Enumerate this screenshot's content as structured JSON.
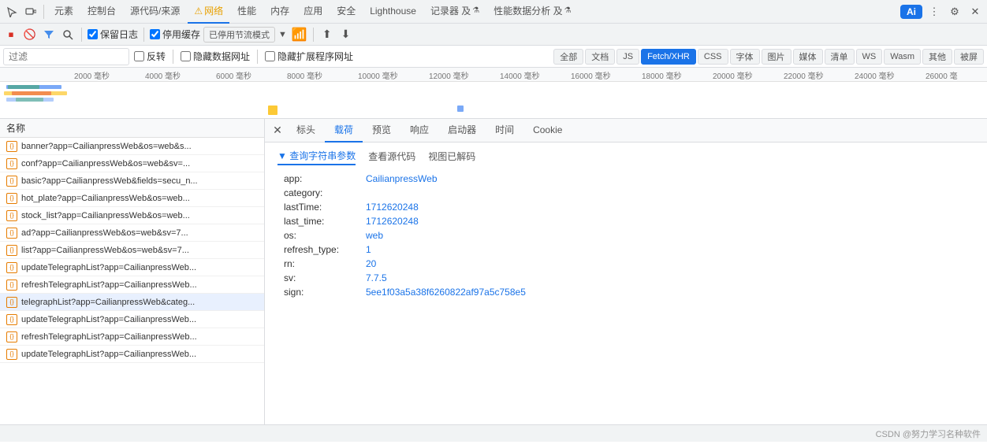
{
  "devtools": {
    "tabs": [
      {
        "label": "元素",
        "id": "elements",
        "active": false
      },
      {
        "label": "控制台",
        "id": "console",
        "active": false
      },
      {
        "label": "源代码/来源",
        "id": "sources",
        "active": false
      },
      {
        "label": "网络",
        "id": "network",
        "active": true,
        "warning": true
      },
      {
        "label": "性能",
        "id": "performance",
        "active": false
      },
      {
        "label": "内存",
        "id": "memory",
        "active": false
      },
      {
        "label": "应用",
        "id": "application",
        "active": false
      },
      {
        "label": "安全",
        "id": "security",
        "active": false
      },
      {
        "label": "Lighthouse",
        "id": "lighthouse",
        "active": false
      },
      {
        "label": "记录器 及",
        "id": "recorder",
        "active": false
      },
      {
        "label": "性能数据分析 及",
        "id": "perf-insights",
        "active": false
      }
    ],
    "toolbar_icons": [
      "cursor-icon",
      "box-icon"
    ]
  },
  "network": {
    "toolbar": {
      "record_title": "停止录制网络日志",
      "clear_title": "清除",
      "filter_title": "过滤",
      "search_title": "搜索",
      "preserve_log_label": "保留日志",
      "disable_cache_label": "停用缓存",
      "disabled_mode_label": "已停用节流模式",
      "upload_label": "导入",
      "download_label": "导出"
    },
    "filter": {
      "placeholder": "过滤",
      "invert_label": "反转",
      "hide_data_urls_label": "隐藏数据网址",
      "hide_extensions_label": "隐藏扩展程序网址"
    },
    "type_buttons": [
      {
        "label": "全部",
        "active": false
      },
      {
        "label": "文档",
        "active": false
      },
      {
        "label": "JS",
        "active": false
      },
      {
        "label": "Fetch/XHR",
        "active": true
      },
      {
        "label": "CSS",
        "active": false
      },
      {
        "label": "字体",
        "active": false
      },
      {
        "label": "图片",
        "active": false
      },
      {
        "label": "媒体",
        "active": false
      },
      {
        "label": "清单",
        "active": false
      },
      {
        "label": "WS",
        "active": false
      },
      {
        "label": "Wasm",
        "active": false
      },
      {
        "label": "其他",
        "active": false
      },
      {
        "label": "被屏",
        "active": false
      }
    ],
    "timeline": {
      "ticks": [
        "2000 毫秒",
        "4000 毫秒",
        "6000 毫秒",
        "8000 毫秒",
        "10000 毫秒",
        "12000 毫秒",
        "14000 毫秒",
        "16000 毫秒",
        "18000 毫秒",
        "20000 毫秒",
        "22000 毫秒",
        "24000 毫秒",
        "26000 毫"
      ]
    }
  },
  "request_list": {
    "header": "名称",
    "items": [
      {
        "name": "banner?app=CailianpressWeb&os=web&s...",
        "selected": false
      },
      {
        "name": "conf?app=CailianpressWeb&os=web&sv=...",
        "selected": false
      },
      {
        "name": "basic?app=CailianpressWeb&fields=secu_n...",
        "selected": false
      },
      {
        "name": "hot_plate?app=CailianpressWeb&os=web...",
        "selected": false
      },
      {
        "name": "stock_list?app=CailianpressWeb&os=web...",
        "selected": false
      },
      {
        "name": "ad?app=CailianpressWeb&os=web&sv=7...",
        "selected": false
      },
      {
        "name": "list?app=CailianpressWeb&os=web&sv=7...",
        "selected": false
      },
      {
        "name": "updateTelegraphList?app=CailianpressWeb...",
        "selected": false
      },
      {
        "name": "refreshTelegraphList?app=CailianpressWeb...",
        "selected": false
      },
      {
        "name": "telegraphList?app=CailianpressWeb&categ...",
        "selected": true
      },
      {
        "name": "updateTelegraphList?app=CailianpressWeb...",
        "selected": false
      },
      {
        "name": "refreshTelegraphList?app=CailianpressWeb...",
        "selected": false
      },
      {
        "name": "updateTelegraphList?app=CailianpressWeb...",
        "selected": false
      }
    ]
  },
  "detail": {
    "tabs": [
      {
        "label": "标头",
        "id": "headers",
        "active": false
      },
      {
        "label": "载荷",
        "id": "payload",
        "active": true
      },
      {
        "label": "预览",
        "id": "preview",
        "active": false
      },
      {
        "label": "响应",
        "id": "response",
        "active": false
      },
      {
        "label": "启动器",
        "id": "initiator",
        "active": false
      },
      {
        "label": "时间",
        "id": "timing",
        "active": false
      },
      {
        "label": "Cookie",
        "id": "cookie",
        "active": false
      }
    ],
    "payload": {
      "sub_tabs": [
        {
          "label": "▼ 查询字符串参数",
          "id": "query",
          "active": true
        },
        {
          "label": "查看源代码",
          "id": "source",
          "active": false
        },
        {
          "label": "视图已解码",
          "id": "decoded",
          "active": false
        }
      ],
      "params": [
        {
          "key": "app:",
          "value": "CailianpressWeb",
          "empty": false
        },
        {
          "key": "category:",
          "value": "",
          "empty": true
        },
        {
          "key": "lastTime:",
          "value": "1712620248",
          "empty": false
        },
        {
          "key": "last_time:",
          "value": "1712620248",
          "empty": false
        },
        {
          "key": "os:",
          "value": "web",
          "empty": false
        },
        {
          "key": "refresh_type:",
          "value": "1",
          "empty": false
        },
        {
          "key": "rn:",
          "value": "20",
          "empty": false
        },
        {
          "key": "sv:",
          "value": "7.7.5",
          "empty": false
        },
        {
          "key": "sign:",
          "value": "5ee1f03a5a38f6260822af97a5c758e5",
          "empty": false
        }
      ]
    }
  },
  "status_bar": {
    "watermark": "CSDN @努力学习名种软件"
  },
  "ai_button": {
    "label": "Ai"
  }
}
